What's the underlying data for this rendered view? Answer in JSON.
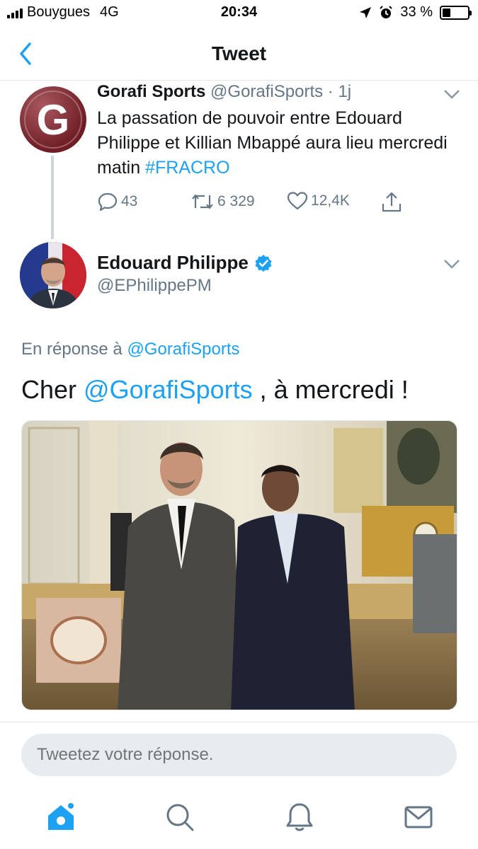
{
  "status_bar": {
    "carrier": "Bouygues",
    "network": "4G",
    "time": "20:34",
    "battery": "33 %",
    "battery_level": 0.33
  },
  "nav": {
    "title": "Tweet",
    "back_icon": "chevron-left-icon"
  },
  "parent_tweet": {
    "author_name": "Gorafi Sports",
    "author_handle": "@GorafiSports",
    "time_sep": " · ",
    "time": "1j",
    "avatar_letter": "G",
    "text_plain": "La passation de pouvoir entre Edouard Philippe et Killian Mbappé aura lieu mercredi matin ",
    "hashtag": "#FRACRO",
    "replies": "43",
    "retweets": "6 329",
    "likes": "12,4K"
  },
  "main_tweet": {
    "author_name": "Edouard Philippe",
    "author_handle": "@EPhilippePM",
    "reply_prefix": "En réponse à ",
    "reply_to": "@GorafiSports",
    "text_before": "Cher ",
    "mention": "@GorafiSports",
    "text_after": " , à mercredi !"
  },
  "reply_box": {
    "placeholder": "Tweetez votre réponse."
  },
  "tab_bar": {
    "items": [
      "home-icon",
      "search-icon",
      "notifications-icon",
      "messages-icon"
    ]
  },
  "colors": {
    "accent": "#1da1f2",
    "muted": "#657786",
    "border": "#e1e8ed"
  }
}
